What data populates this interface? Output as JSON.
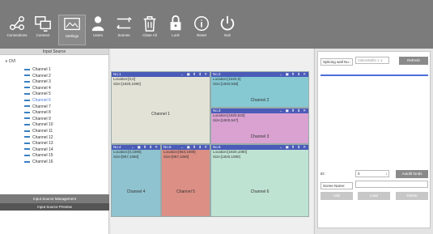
{
  "toolbar": {
    "buttons": [
      {
        "label": "Connections",
        "icon": "connections-icon"
      },
      {
        "label": "Connect",
        "icon": "connect-icon"
      },
      {
        "label": "Settings",
        "icon": "settings-icon"
      },
      {
        "label": "Users",
        "icon": "users-icon"
      },
      {
        "label": "Scenes",
        "icon": "scenes-icon"
      },
      {
        "label": "Close All",
        "icon": "trash-icon"
      },
      {
        "label": "Lock",
        "icon": "lock-icon"
      },
      {
        "label": "Reset",
        "icon": "reset-icon"
      },
      {
        "label": "Exit",
        "icon": "power-icon"
      }
    ]
  },
  "left": {
    "title": "Input Source",
    "root": "DVI",
    "channels": [
      "Channel 1",
      "Channel 2",
      "Channel 3",
      "Channel 4",
      "Channel 5",
      "Channel 6",
      "Channel 7",
      "Channel 8",
      "Channel 9",
      "Channel 10",
      "Channel 11",
      "Channel 12",
      "Channel 13",
      "Channel 14",
      "Channel 15",
      "Channel 16"
    ],
    "selected_index": 5,
    "footer1": "Input Source Management",
    "footer2": "Input Source Preview"
  },
  "windows": [
    {
      "no": "No.1",
      "loc": "Location:[0,0]",
      "size": "Size:[1920,1080]",
      "ch": "Channel 1",
      "color": "#e2e2d6"
    },
    {
      "no": "No.2",
      "loc": "Location:[1920,0]",
      "size": "Size:[1920,538]",
      "ch": "Channel 2",
      "color": "#86c9d3"
    },
    {
      "no": "No.3",
      "loc": "Location:[1920,533]",
      "size": "Size:[1920,547]",
      "ch": "Channel 3",
      "color": "#d9a2d1"
    },
    {
      "no": "No.4",
      "loc": "Location:[0,1080]",
      "size": "Size:[957,1080]",
      "ch": "Channel 4",
      "color": "#8fc3cf"
    },
    {
      "no": "No.5",
      "loc": "Location:[963,1080]",
      "size": "Size:[957,1080]",
      "ch": "Channel 5",
      "color": "#dc8f84"
    },
    {
      "no": "No.6",
      "loc": "Location:[1920,1080]",
      "size": "Size:[1920,1080]",
      "ch": "Channel 6",
      "color": "#bfe3d3"
    }
  ],
  "window_controls": "← ▣ ⬆ ⬇ ✕",
  "right": {
    "wall_label": "Splicing wall No.:",
    "wall_value": "VideoWall1-1 ∨",
    "refresh": "Refresh",
    "id_label": "ID:",
    "id_value": "0",
    "spinner": "↕",
    "autofit": "Autofit fonds",
    "scene_label": "Scene Name:",
    "scene_value": "",
    "add": "Add",
    "load": "Load",
    "delete": "Delete",
    "accent": "#4a6fd8"
  }
}
